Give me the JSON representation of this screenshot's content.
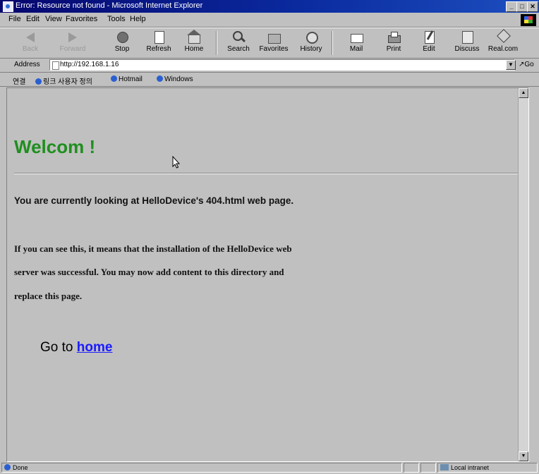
{
  "window": {
    "title": "Error: Resource not found - Microsoft Internet Explorer",
    "controls": [
      "_",
      "□",
      "✕"
    ]
  },
  "menu": [
    "File",
    "Edit",
    "View",
    "Favorites",
    "Tools",
    "Help"
  ],
  "toolbar": {
    "back": "Back",
    "forward": "Forward",
    "stop": "Stop",
    "refresh": "Refresh",
    "home": "Home",
    "search": "Search",
    "favorites": "Favorites",
    "history": "History",
    "mail": "Mail",
    "print": "Print",
    "edit": "Edit",
    "discuss": "Discuss",
    "realcom": "Real.com"
  },
  "address": {
    "label": "Address",
    "url": "http://192.168.1.16",
    "go": "Go"
  },
  "links": {
    "label": "연결",
    "items": [
      "링크 사용자 정의",
      "Hotmail",
      "Windows"
    ]
  },
  "content": {
    "heading": "Welcom !",
    "subheading": "You are currently looking at HelloDevice's 404.html web page.",
    "para_line1": "If you can see this, it means that the installation of the HelloDevice web",
    "para_line2": "server was successful. You may now add content to this directory and",
    "para_line3": "replace this page.",
    "goto_prefix": "Go to",
    "goto_link": "home"
  },
  "status": {
    "text": "Done",
    "zone": "Local intranet"
  },
  "colors": {
    "welcome": "#1f8f1f",
    "link": "#1a1aff",
    "titlebar": "#06066e"
  }
}
